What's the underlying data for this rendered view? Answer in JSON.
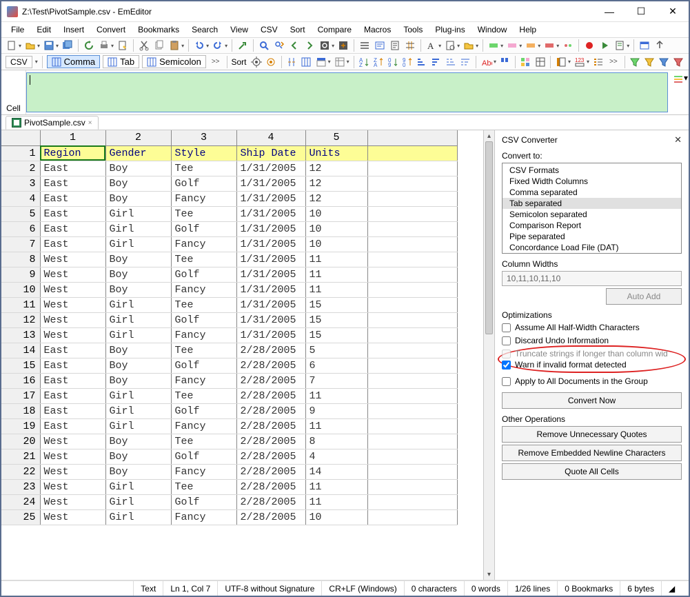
{
  "title": "Z:\\Test\\PivotSample.csv - EmEditor",
  "window_controls": {
    "min": "—",
    "max": "☐",
    "close": "✕"
  },
  "menus": [
    "File",
    "Edit",
    "Insert",
    "Convert",
    "Bookmarks",
    "Search",
    "View",
    "CSV",
    "Sort",
    "Compare",
    "Macros",
    "Tools",
    "Plug-ins",
    "Window",
    "Help"
  ],
  "toolbar2": {
    "csv_label": "CSV",
    "ovf": ">>",
    "comma": "Comma",
    "tab": "Tab",
    "semi": "Semicolon",
    "sort_label": "Sort"
  },
  "cell_row": {
    "label": "Cell"
  },
  "filetab": {
    "name": "PivotSample.csv",
    "close": "×"
  },
  "columns": [
    "1",
    "2",
    "3",
    "4",
    "5"
  ],
  "rows": [
    {
      "n": "1",
      "c": [
        "Region",
        "Gender",
        "Style",
        "Ship Date",
        "Units"
      ],
      "header": true,
      "sel": true
    },
    {
      "n": "2",
      "c": [
        "East",
        "Boy",
        "Tee",
        "1/31/2005",
        "12"
      ]
    },
    {
      "n": "3",
      "c": [
        "East",
        "Boy",
        "Golf",
        "1/31/2005",
        "12"
      ]
    },
    {
      "n": "4",
      "c": [
        "East",
        "Boy",
        "Fancy",
        "1/31/2005",
        "12"
      ]
    },
    {
      "n": "5",
      "c": [
        "East",
        "Girl",
        "Tee",
        "1/31/2005",
        "10"
      ]
    },
    {
      "n": "6",
      "c": [
        "East",
        "Girl",
        "Golf",
        "1/31/2005",
        "10"
      ]
    },
    {
      "n": "7",
      "c": [
        "East",
        "Girl",
        "Fancy",
        "1/31/2005",
        "10"
      ]
    },
    {
      "n": "8",
      "c": [
        "West",
        "Boy",
        "Tee",
        "1/31/2005",
        "11"
      ]
    },
    {
      "n": "9",
      "c": [
        "West",
        "Boy",
        "Golf",
        "1/31/2005",
        "11"
      ]
    },
    {
      "n": "10",
      "c": [
        "West",
        "Boy",
        "Fancy",
        "1/31/2005",
        "11"
      ]
    },
    {
      "n": "11",
      "c": [
        "West",
        "Girl",
        "Tee",
        "1/31/2005",
        "15"
      ]
    },
    {
      "n": "12",
      "c": [
        "West",
        "Girl",
        "Golf",
        "1/31/2005",
        "15"
      ]
    },
    {
      "n": "13",
      "c": [
        "West",
        "Girl",
        "Fancy",
        "1/31/2005",
        "15"
      ]
    },
    {
      "n": "14",
      "c": [
        "East",
        "Boy",
        "Tee",
        "2/28/2005",
        "5"
      ]
    },
    {
      "n": "15",
      "c": [
        "East",
        "Boy",
        "Golf",
        "2/28/2005",
        "6"
      ]
    },
    {
      "n": "16",
      "c": [
        "East",
        "Boy",
        "Fancy",
        "2/28/2005",
        "7"
      ]
    },
    {
      "n": "17",
      "c": [
        "East",
        "Girl",
        "Tee",
        "2/28/2005",
        "11"
      ]
    },
    {
      "n": "18",
      "c": [
        "East",
        "Girl",
        "Golf",
        "2/28/2005",
        "9"
      ]
    },
    {
      "n": "19",
      "c": [
        "East",
        "Girl",
        "Fancy",
        "2/28/2005",
        "11"
      ]
    },
    {
      "n": "20",
      "c": [
        "West",
        "Boy",
        "Tee",
        "2/28/2005",
        "8"
      ]
    },
    {
      "n": "21",
      "c": [
        "West",
        "Boy",
        "Golf",
        "2/28/2005",
        "4"
      ]
    },
    {
      "n": "22",
      "c": [
        "West",
        "Boy",
        "Fancy",
        "2/28/2005",
        "14"
      ]
    },
    {
      "n": "23",
      "c": [
        "West",
        "Girl",
        "Tee",
        "2/28/2005",
        "11"
      ]
    },
    {
      "n": "24",
      "c": [
        "West",
        "Girl",
        "Golf",
        "2/28/2005",
        "11"
      ]
    },
    {
      "n": "25",
      "c": [
        "West",
        "Girl",
        "Fancy",
        "2/28/2005",
        "10"
      ]
    }
  ],
  "panel": {
    "title": "CSV Converter",
    "close": "✕",
    "convert_to_label": "Convert to:",
    "formats": [
      "CSV Formats",
      "Fixed Width Columns",
      "Comma separated",
      "Tab separated",
      "Semicolon separated",
      "Comparison Report",
      "Pipe separated",
      "Concordance Load File (DAT)"
    ],
    "formats_selected_index": 3,
    "column_widths_label": "Column Widths",
    "column_widths_value": "10,11,10,11,10",
    "auto_add": "Auto Add",
    "optimizations_label": "Optimizations",
    "opt1": "Assume All Half-Width Characters",
    "opt2": "Discard Undo Information",
    "opt3": "Truncate strings if longer than column wid",
    "opt4": "Warn if invalid format detected",
    "apply_all": "Apply to All Documents in the Group",
    "convert_now": "Convert Now",
    "other_ops_label": "Other Operations",
    "remove_quotes": "Remove Unnecessary Quotes",
    "remove_newlines": "Remove Embedded Newline Characters",
    "quote_all": "Quote All Cells"
  },
  "status": {
    "mode": "Text",
    "pos": "Ln 1, Col 7",
    "enc": "UTF-8 without Signature",
    "le": "CR+LF (Windows)",
    "chars": "0 characters",
    "words": "0 words",
    "lines": "1/26 lines",
    "bm": "0 Bookmarks",
    "bytes": "6 bytes"
  }
}
